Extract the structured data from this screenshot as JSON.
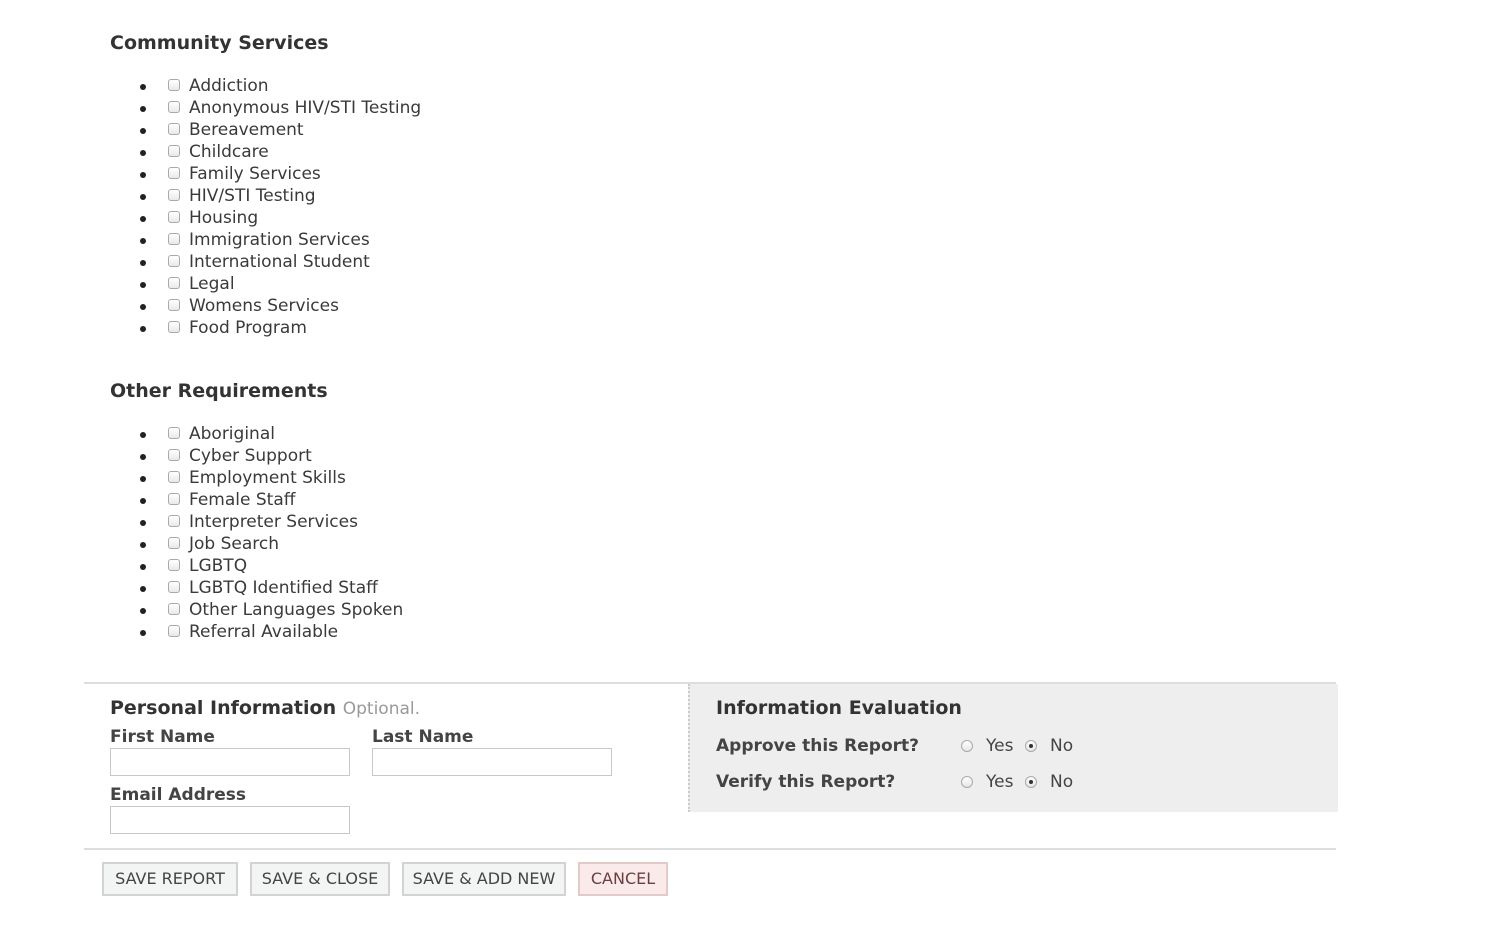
{
  "community_services": {
    "title": "Community Services",
    "items": [
      {
        "label": "Addiction",
        "checked": false
      },
      {
        "label": "Anonymous HIV/STI Testing",
        "checked": false
      },
      {
        "label": "Bereavement",
        "checked": false
      },
      {
        "label": "Childcare",
        "checked": false
      },
      {
        "label": "Family Services",
        "checked": false
      },
      {
        "label": "HIV/STI Testing",
        "checked": false
      },
      {
        "label": "Housing",
        "checked": false
      },
      {
        "label": "Immigration Services",
        "checked": false
      },
      {
        "label": "International Student",
        "checked": false
      },
      {
        "label": "Legal",
        "checked": false
      },
      {
        "label": "Womens Services",
        "checked": false
      },
      {
        "label": "Food Program",
        "checked": false
      }
    ]
  },
  "other_requirements": {
    "title": "Other Requirements",
    "items": [
      {
        "label": "Aboriginal",
        "checked": false
      },
      {
        "label": "Cyber Support",
        "checked": false
      },
      {
        "label": "Employment Skills",
        "checked": false
      },
      {
        "label": "Female Staff",
        "checked": false
      },
      {
        "label": "Interpreter Services",
        "checked": false
      },
      {
        "label": "Job Search",
        "checked": false
      },
      {
        "label": "LGBTQ",
        "checked": false
      },
      {
        "label": "LGBTQ Identified Staff",
        "checked": false
      },
      {
        "label": "Other Languages Spoken",
        "checked": false
      },
      {
        "label": "Referral Available",
        "checked": false
      }
    ]
  },
  "personal_information": {
    "title": "Personal Information",
    "optional_note": "Optional.",
    "first_name_label": "First Name",
    "first_name_value": "",
    "last_name_label": "Last Name",
    "last_name_value": "",
    "email_label": "Email Address",
    "email_value": ""
  },
  "information_evaluation": {
    "title": "Information Evaluation",
    "questions": [
      {
        "label": "Approve this Report?",
        "yes_label": "Yes",
        "no_label": "No",
        "selected": "No"
      },
      {
        "label": "Verify this Report?",
        "yes_label": "Yes",
        "no_label": "No",
        "selected": "No"
      }
    ]
  },
  "actions": {
    "save_report": "SAVE REPORT",
    "save_close": "SAVE & CLOSE",
    "save_add_new": "SAVE & ADD NEW",
    "cancel": "CANCEL"
  },
  "colors": {
    "cancel_background": "#fbeaea",
    "button_background": "#f3f5f5",
    "evaluation_background": "#eeeeee"
  }
}
